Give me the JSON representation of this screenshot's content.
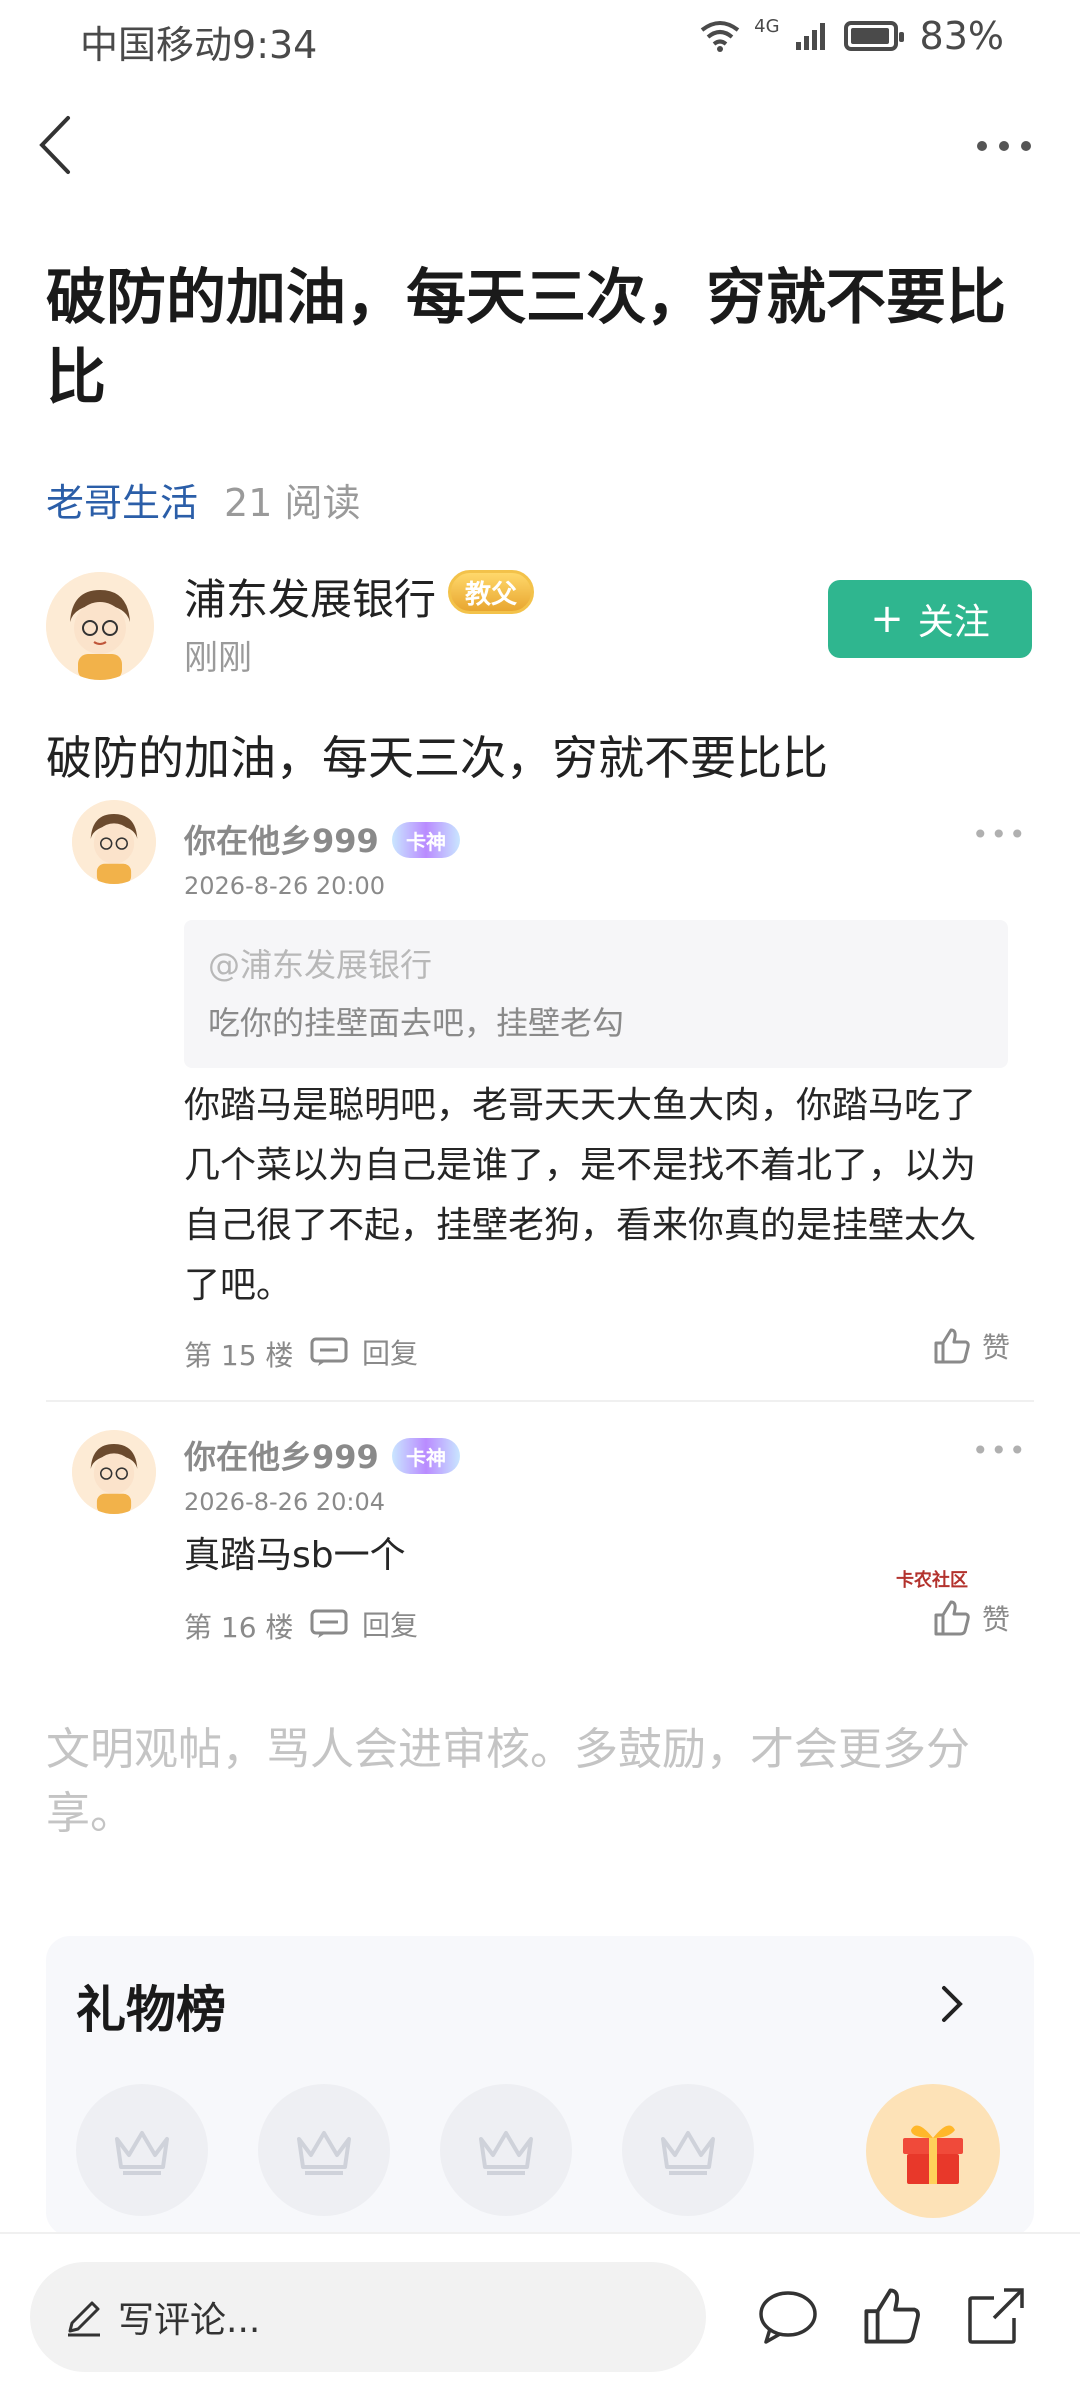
{
  "status_bar": {
    "carrier": "中国移动",
    "time": "9:34",
    "network": "4G",
    "battery": "83%"
  },
  "nav": {
    "back_icon": "chevron-left-icon",
    "more_icon": "more-horizontal-icon"
  },
  "post": {
    "title": "破防的加油，每天三次，穷就不要比比",
    "category": "老哥生活",
    "reads": "21 阅读",
    "author": {
      "name": "浦东发展银行",
      "badge": "教父",
      "time": "刚刚"
    },
    "follow_label": "关注",
    "body": "破防的加油，每天三次，穷就不要比比"
  },
  "comments": [
    {
      "user": "你在他乡999",
      "badge": "卡神",
      "date": "2026-8-26 20:00",
      "quote_at": "@浦东发展银行",
      "quote_text": "吃你的挂壁面去吧，挂壁老勾",
      "text_lines": [
        "你踏马是聪明吧，老哥天天大鱼大肉，你踏马吃了",
        "几个菜以为自己是谁了，是不是找不着北了，以为",
        "自己很了不起，挂壁老狗，看来你真的是挂壁太久",
        "了吧。"
      ],
      "floor": "第 15 楼",
      "reply": "回复",
      "like": "赞"
    },
    {
      "user": "你在他乡999",
      "badge": "卡神",
      "date": "2026-8-26 20:04",
      "text": "真踏马sb一个",
      "floor": "第 16 楼",
      "reply": "回复",
      "like": "赞",
      "watermark": "卡农社区"
    }
  ],
  "notice": "文明观帖，骂人会进审核。多鼓励，才会更多分享。",
  "gift_board": {
    "title": "礼物榜"
  },
  "bottom_bar": {
    "comment_placeholder": "写评论..."
  },
  "colors": {
    "accent": "#2fb68f",
    "link": "#2b5ea8"
  }
}
